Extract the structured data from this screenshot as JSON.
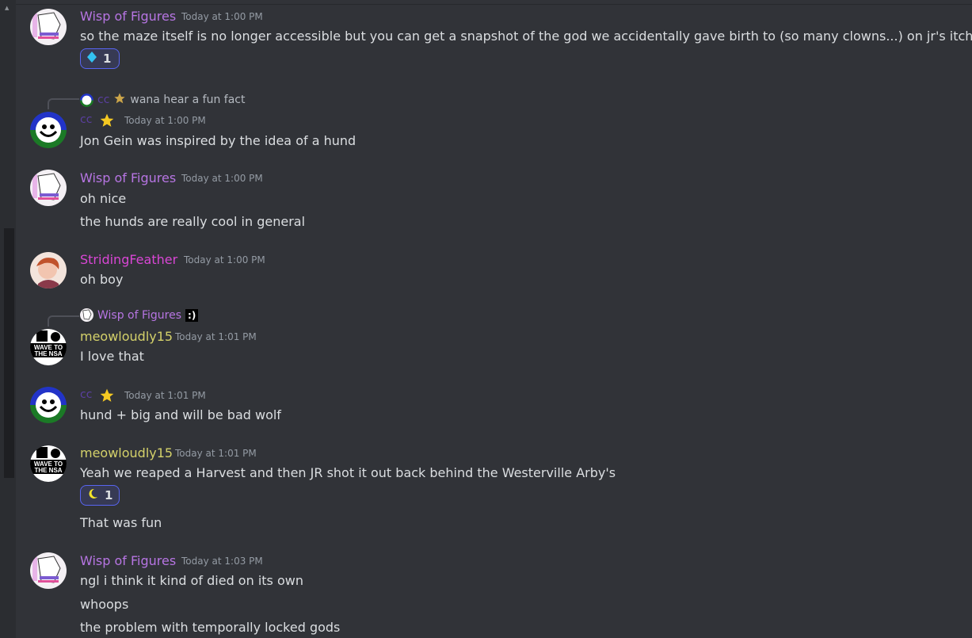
{
  "messages": [
    {
      "author": "Wisp of Figures",
      "timestamp": "Today at 1:00 PM",
      "lines": [
        "so the maze itself is no longer accessible but you can get a snapshot of the god we accidentally gave birth to (so many clowns...) on jr's itch"
      ],
      "reaction": {
        "icon": "diamond-icon",
        "count": "1"
      }
    },
    {
      "reply_to": {
        "author": "cc",
        "text": "wana hear a fun fact"
      },
      "author": "cc",
      "timestamp": "Today at 1:00 PM",
      "lines": [
        "Jon Gein was inspired by the idea of a hund"
      ]
    },
    {
      "author": "Wisp of Figures",
      "timestamp": "Today at 1:00 PM",
      "lines": [
        "oh nice",
        "the hunds are really cool in general"
      ]
    },
    {
      "author": "StridingFeather",
      "timestamp": "Today at 1:00 PM",
      "lines": [
        "oh boy"
      ]
    },
    {
      "reply_to": {
        "author": "Wisp of Figures",
        "text": ":)"
      },
      "author": "meowloudly15",
      "timestamp": "Today at 1:01 PM",
      "lines": [
        "I love that"
      ]
    },
    {
      "author": "cc",
      "timestamp": "Today at 1:01 PM",
      "lines": [
        "hund + big and will be bad wolf"
      ]
    },
    {
      "author": "meowloudly15",
      "timestamp": "Today at 1:01 PM",
      "lines": [
        "Yeah we reaped a Harvest and then JR shot it out back behind the Westerville Arby's",
        "That was fun"
      ],
      "reaction": {
        "icon": "crescent-moon-icon",
        "count": "1"
      }
    },
    {
      "author": "Wisp of Figures",
      "timestamp": "Today at 1:03 PM",
      "lines": [
        "ngl i think it kind of died on its own",
        "whoops",
        "the problem with temporally locked gods"
      ]
    }
  ],
  "avatar_text": {
    "meowloudly15": [
      "WAVE TO",
      "THE NSA"
    ]
  },
  "colors": {
    "background": "#313338",
    "wisp_name": "#b775e3",
    "cc_name": "#5a3fa0",
    "striding_name": "#d946d5",
    "meow_name": "#d4d16a",
    "reaction_border": "#5865f2"
  }
}
